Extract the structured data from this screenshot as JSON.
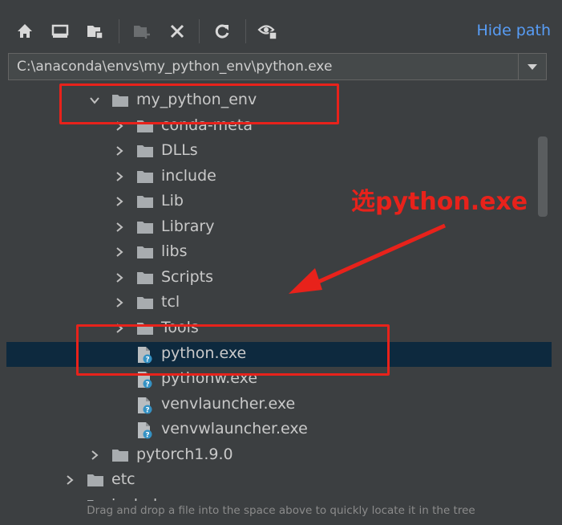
{
  "toolbar": {
    "buttons": [
      {
        "icon": "home-icon"
      },
      {
        "icon": "desktop-icon"
      },
      {
        "icon": "project-icon"
      },
      {
        "icon": "new-folder-icon"
      },
      {
        "icon": "delete-icon"
      },
      {
        "icon": "refresh-icon"
      },
      {
        "icon": "show-hidden-icon"
      }
    ],
    "hide_path_label": "Hide path"
  },
  "path": {
    "value": "C:\\anaconda\\envs\\my_python_env\\python.exe"
  },
  "tree": {
    "rows": [
      {
        "label": "my_python_env",
        "type": "folder",
        "state": "expanded"
      },
      {
        "label": "conda-meta",
        "type": "folder",
        "state": "collapsed"
      },
      {
        "label": "DLLs",
        "type": "folder",
        "state": "collapsed"
      },
      {
        "label": "include",
        "type": "folder",
        "state": "collapsed"
      },
      {
        "label": "Lib",
        "type": "folder",
        "state": "collapsed"
      },
      {
        "label": "Library",
        "type": "folder",
        "state": "collapsed"
      },
      {
        "label": "libs",
        "type": "folder",
        "state": "collapsed"
      },
      {
        "label": "Scripts",
        "type": "folder",
        "state": "collapsed"
      },
      {
        "label": "tcl",
        "type": "folder",
        "state": "collapsed"
      },
      {
        "label": "Tools",
        "type": "folder",
        "state": "collapsed"
      },
      {
        "label": "python.exe",
        "type": "file",
        "selected": true
      },
      {
        "label": "pythonw.exe",
        "type": "file"
      },
      {
        "label": "venvlauncher.exe",
        "type": "file"
      },
      {
        "label": "venvwlauncher.exe",
        "type": "file"
      },
      {
        "label": "pytorch1.9.0",
        "type": "folder",
        "state": "collapsed"
      },
      {
        "label": "etc",
        "type": "folder",
        "state": "collapsed"
      },
      {
        "label": "include",
        "type": "folder",
        "state": "collapsed"
      }
    ]
  },
  "hint": "Drag and drop a file into the space above to quickly locate it in the tree",
  "annotation": {
    "text": "选python.exe",
    "color": "#e8221b"
  },
  "colors": {
    "background": "#3c3f41",
    "selection": "#0d293e",
    "link": "#589df6",
    "folder": "#a8acaf"
  }
}
